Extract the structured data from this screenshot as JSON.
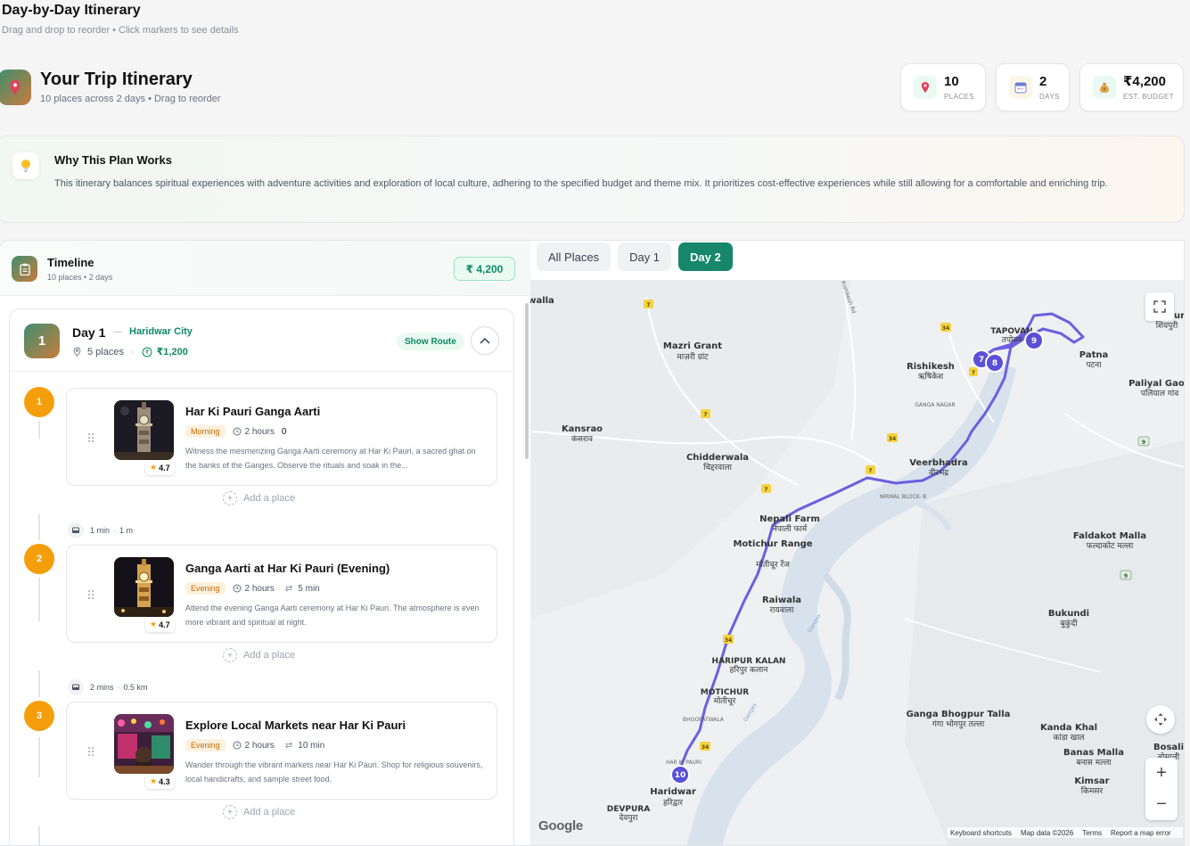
{
  "page": {
    "title": "Day-by-Day Itinerary",
    "subtitle": "Drag and drop to reorder • Click markers to see details"
  },
  "hero": {
    "title": "Your Trip Itinerary",
    "subtitle": "10 places across 2 days • Drag to reorder"
  },
  "stats": [
    {
      "value": "10",
      "label": "PLACES",
      "icon": "pin-icon"
    },
    {
      "value": "2",
      "label": "DAYS",
      "icon": "calendar-icon"
    },
    {
      "value": "₹4,200",
      "label": "EST. BUDGET",
      "icon": "money-bag-icon"
    }
  ],
  "why": {
    "title": "Why This Plan Works",
    "text": "This itinerary balances spiritual experiences with adventure activities and exploration of local culture, adhering to the specified budget and theme mix. It prioritizes cost-effective experiences while still allowing for a comfortable and enriching trip."
  },
  "timeline": {
    "title": "Timeline",
    "subtitle": "10 places • 2 days",
    "budget": "₹ 4,200"
  },
  "day1": {
    "badge": "1",
    "title": "Day 1",
    "city": "Haridwar City",
    "places": "5 places",
    "budget": "₹1,200",
    "show_route": "Show Route"
  },
  "places": [
    {
      "num": "1",
      "title": "Har Ki Pauri Ganga Aarti",
      "time_tag": "Morning",
      "duration": "2 hours",
      "travel": "0",
      "rating": "4.7",
      "desc": "Witness the mesmerizing Ganga Aarti ceremony at Har Ki Pauri, a sacred ghat on the banks of the Ganges. Observe the rituals and soak in the..."
    },
    {
      "num": "2",
      "title": "Ganga Aarti at Har Ki Pauri (Evening)",
      "time_tag": "Evening",
      "duration": "2 hours",
      "travel": "5 min",
      "rating": "4.7",
      "desc": "Attend the evening Ganga Aarti ceremony at Har Ki Pauri. The atmosphere is even more vibrant and spiritual at night."
    },
    {
      "num": "3",
      "title": "Explore Local Markets near Har Ki Pauri",
      "time_tag": "Evening",
      "duration": "2 hours",
      "travel": "10 min",
      "rating": "4.3",
      "desc": "Wander through the vibrant markets near Har Ki Pauri. Shop for religious souvenirs, local handicrafts, and sample street food."
    }
  ],
  "add_place": "Add a place",
  "travel_legs": [
    {
      "time": "1 min",
      "dist": "1 m"
    },
    {
      "time": "2 mins",
      "dist": "0.5 km"
    }
  ],
  "tabs": [
    "All Places",
    "Day 1",
    "Day 2"
  ],
  "active_tab": "Day 2",
  "map": {
    "labels": [
      {
        "en": "Mazri Grant",
        "hi": "माज़री ग्रांट"
      },
      {
        "en": "Rishikesh",
        "hi": "ऋषिकेश"
      },
      {
        "en": "Kansrao",
        "hi": "कंसराव"
      },
      {
        "en": "Chidderwala",
        "hi": "चिद्दरवाला"
      },
      {
        "en": "Veerbhadra",
        "hi": "वीरभद्र"
      },
      {
        "en": "Nepali Farm",
        "hi": "नेपाली फार्म"
      },
      {
        "en": "Motichur Range",
        "hi": "मोतीचूर रेंज"
      },
      {
        "en": "Raiwala",
        "hi": "रायवाला"
      },
      {
        "en": "HARIPUR KALAN",
        "hi": "हरिपुर कलान"
      },
      {
        "en": "MOTICHUR",
        "hi": "मोतीचूर"
      },
      {
        "en": "Haridwar",
        "hi": "हरिद्वार"
      },
      {
        "en": "DEVPURA",
        "hi": "देवपुरा"
      },
      {
        "en": "Patna",
        "hi": "पटना"
      },
      {
        "en": "Paliyal Gaon",
        "hi": "पलियाल गांव"
      },
      {
        "en": "Faldakot Malla",
        "hi": "फल्दाकोट मल्ला"
      },
      {
        "en": "Bukundi",
        "hi": "बुकुंदी"
      },
      {
        "en": "Ganga Bhogpur Talla",
        "hi": "गंगा भोगपुर तल्ला"
      },
      {
        "en": "Kanda Khal",
        "hi": "कांडा खाल"
      },
      {
        "en": "Banas Malla",
        "hi": "बनास मल्ला"
      },
      {
        "en": "Kimsar",
        "hi": "किमसर"
      },
      {
        "en": "Bosali",
        "hi": "बोसाली"
      },
      {
        "en": "Shivpuri",
        "hi": "शिवपुरी"
      },
      {
        "en": "TAPOVAN",
        "hi": "तपोवन"
      }
    ],
    "small_labels": [
      "GANGA NAGAR",
      "NIRMAL BLOCK- B",
      "BHOOPATWALA",
      "HAR KI PAURI",
      "Ganges",
      "Rishikesh Rd",
      "walla"
    ],
    "markers": [
      "7",
      "8",
      "9",
      "10"
    ],
    "footer": [
      "Keyboard shortcuts",
      "Map data ©2026",
      "Terms",
      "Report a map error"
    ],
    "google": "Google"
  }
}
